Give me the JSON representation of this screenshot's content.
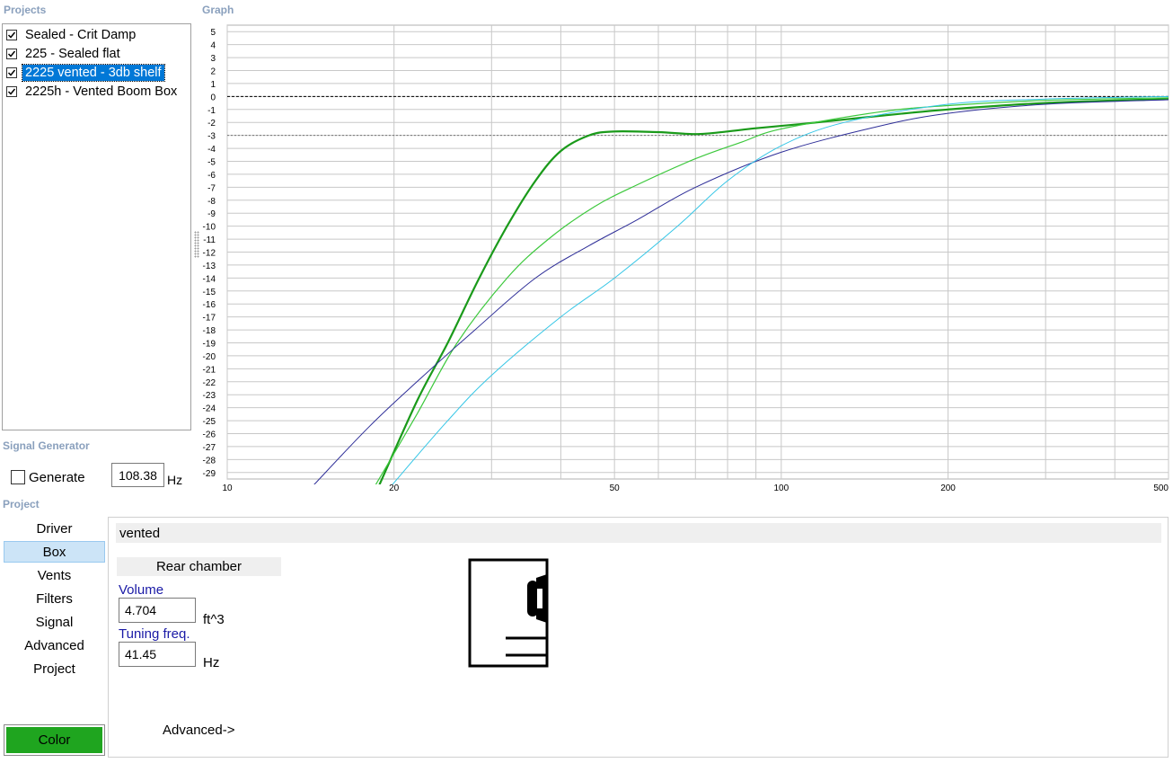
{
  "sections": {
    "projects": "Projects",
    "graph": "Graph",
    "signal_generator": "Signal Generator",
    "project": "Project"
  },
  "projects": [
    {
      "label": "Sealed - Crit Damp",
      "checked": true,
      "selected": false
    },
    {
      "label": "225 - Sealed flat",
      "checked": true,
      "selected": false
    },
    {
      "label": "2225 vented - 3db shelf",
      "checked": true,
      "selected": true
    },
    {
      "label": "2225h - Vented Boom Box",
      "checked": true,
      "selected": false
    }
  ],
  "signal_generator": {
    "generate_label": "Generate",
    "generate_checked": false,
    "frequency": "108.38",
    "unit": "Hz"
  },
  "nav": {
    "items": [
      "Driver",
      "Box",
      "Vents",
      "Filters",
      "Signal",
      "Advanced",
      "Project"
    ],
    "active": "Box",
    "color_button": "Color",
    "color_value": "#1fa51f"
  },
  "box_panel": {
    "header": "vented",
    "chamber_button": "Rear chamber",
    "volume_label": "Volume",
    "volume_value": "4.704",
    "volume_unit": "ft^3",
    "tuning_label": "Tuning freq.",
    "tuning_value": "41.45",
    "tuning_unit": "Hz",
    "advanced_link": "Advanced->"
  },
  "chart_data": {
    "type": "line",
    "xscale": "log",
    "xlim": [
      10,
      500
    ],
    "ylim": [
      -29.5,
      5.5
    ],
    "x_ticks": [
      10,
      20,
      50,
      100,
      200,
      500
    ],
    "y_ticks": [
      5,
      4,
      3,
      2,
      1,
      0,
      -1,
      -2,
      -3,
      -4,
      -5,
      -6,
      -7,
      -8,
      -9,
      -10,
      -11,
      -12,
      -13,
      -14,
      -15,
      -16,
      -17,
      -18,
      -19,
      -20,
      -21,
      -22,
      -23,
      -24,
      -25,
      -26,
      -27,
      -28,
      -29
    ],
    "reference_lines": [
      0,
      -3
    ],
    "grid": true,
    "series": [
      {
        "color": "#1a9a1a",
        "stroke": 2.2,
        "points": [
          [
            18.8,
            -30
          ],
          [
            22,
            -23.5
          ],
          [
            25,
            -19
          ],
          [
            28.5,
            -14
          ],
          [
            32,
            -10
          ],
          [
            36,
            -6.5
          ],
          [
            40,
            -4.2
          ],
          [
            45,
            -3.0
          ],
          [
            50,
            -2.7
          ],
          [
            60,
            -2.75
          ],
          [
            70,
            -2.9
          ],
          [
            80,
            -2.7
          ],
          [
            90,
            -2.45
          ],
          [
            110,
            -2.1
          ],
          [
            150,
            -1.5
          ],
          [
            200,
            -1.0
          ],
          [
            300,
            -0.5
          ],
          [
            500,
            -0.2
          ]
        ]
      },
      {
        "color": "#3cc83c",
        "stroke": 1.2,
        "points": [
          [
            18.5,
            -30
          ],
          [
            22,
            -24.5
          ],
          [
            26,
            -19
          ],
          [
            32,
            -14
          ],
          [
            38,
            -11
          ],
          [
            46,
            -8.5
          ],
          [
            55,
            -6.8
          ],
          [
            70,
            -4.8
          ],
          [
            85,
            -3.5
          ],
          [
            100,
            -2.5
          ],
          [
            150,
            -1.2
          ],
          [
            200,
            -0.7
          ],
          [
            300,
            -0.3
          ],
          [
            500,
            -0.1
          ]
        ]
      },
      {
        "color": "#2e2e98",
        "stroke": 1,
        "points": [
          [
            14.3,
            -30
          ],
          [
            18,
            -25.5
          ],
          [
            22,
            -22
          ],
          [
            28,
            -18
          ],
          [
            36,
            -14
          ],
          [
            45,
            -11.5
          ],
          [
            55,
            -9.5
          ],
          [
            70,
            -7
          ],
          [
            100,
            -4.3
          ],
          [
            150,
            -2.3
          ],
          [
            200,
            -1.3
          ],
          [
            300,
            -0.6
          ],
          [
            500,
            -0.25
          ]
        ]
      },
      {
        "color": "#35c6e6",
        "stroke": 1,
        "points": [
          [
            19.8,
            -30
          ],
          [
            25,
            -25
          ],
          [
            30,
            -21.5
          ],
          [
            40,
            -17
          ],
          [
            50,
            -14
          ],
          [
            65,
            -10
          ],
          [
            80,
            -6.5
          ],
          [
            100,
            -3.8
          ],
          [
            130,
            -2
          ],
          [
            200,
            -0.6
          ],
          [
            300,
            -0.2
          ],
          [
            500,
            0
          ]
        ]
      }
    ]
  }
}
